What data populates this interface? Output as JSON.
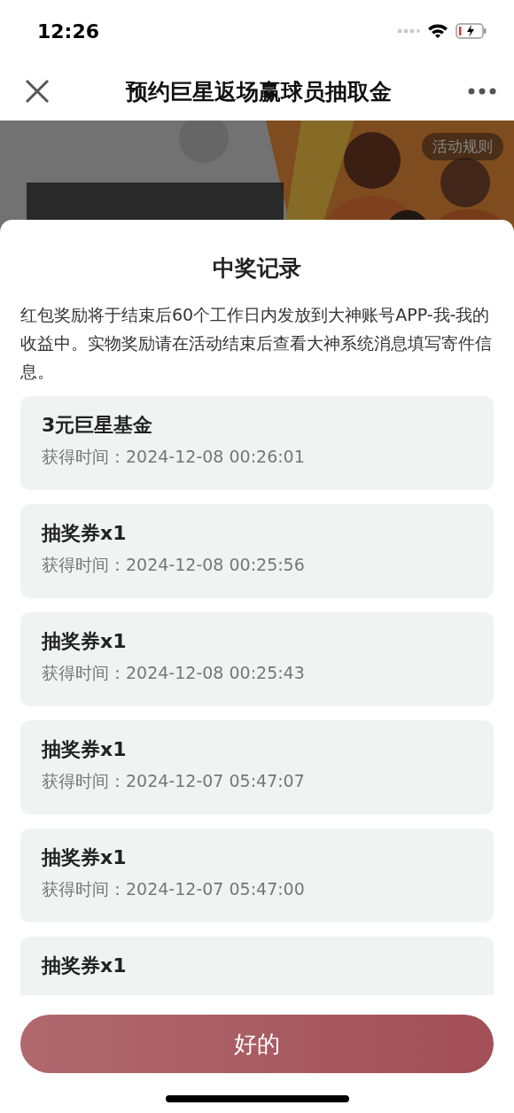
{
  "status_bar": {
    "time": "12:26"
  },
  "nav": {
    "title": "预约巨星返场赢球员抽取金"
  },
  "banner": {
    "kind": "picture",
    "rules_button": "活动规则"
  },
  "sheet": {
    "title": "中奖记录",
    "notice": "红包奖励将于结束后60个工作日内发放到大神账号APP-我-我的收益中。实物奖励请在活动结束后查看大神系统消息填写寄件信息。",
    "records": [
      {
        "prize": "3元巨星基金",
        "time": "获得时间：2024-12-08 00:26:01"
      },
      {
        "prize": "抽奖券x1",
        "time": "获得时间：2024-12-08 00:25:56"
      },
      {
        "prize": "抽奖券x1",
        "time": "获得时间：2024-12-08 00:25:43"
      },
      {
        "prize": "抽奖券x1",
        "time": "获得时间：2024-12-07 05:47:07"
      },
      {
        "prize": "抽奖券x1",
        "time": "获得时间：2024-12-07 05:47:00"
      },
      {
        "prize": "抽奖券x1"
      }
    ],
    "confirm_button": "好的"
  }
}
